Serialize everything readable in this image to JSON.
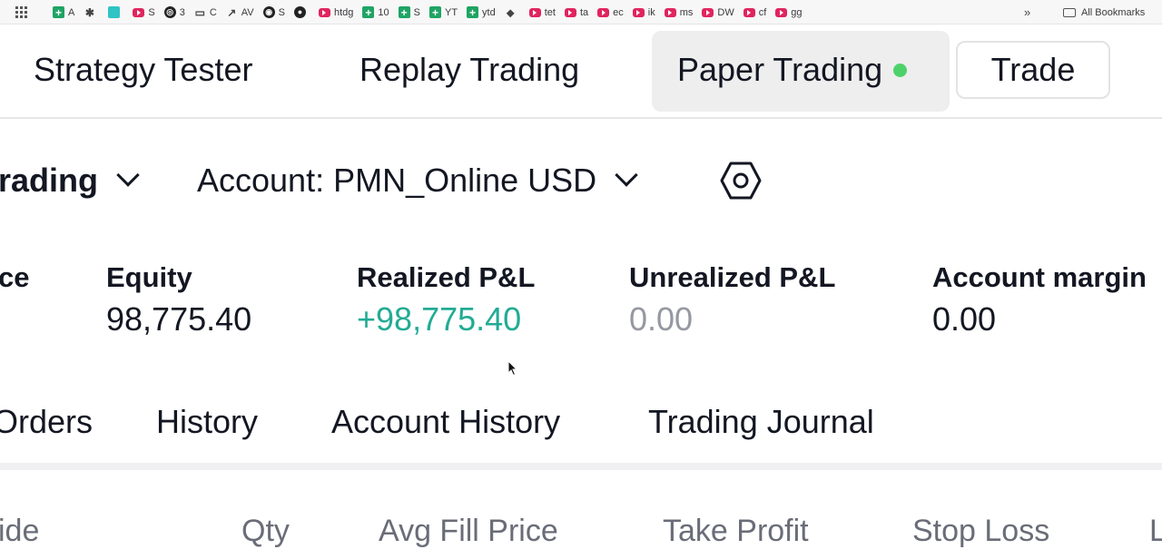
{
  "bookmarks_bar": {
    "items": [
      {
        "icon": "sheets-icon",
        "label": "A"
      },
      {
        "icon": "puzzle-icon",
        "label": ""
      },
      {
        "icon": "app-icon",
        "label": ""
      },
      {
        "icon": "youtube-icon",
        "label": "S"
      },
      {
        "icon": "openai-icon",
        "label": "3"
      },
      {
        "icon": "folder-icon",
        "label": "C"
      },
      {
        "icon": "chart-icon",
        "label": "AV"
      },
      {
        "icon": "globe-icon",
        "label": "S"
      },
      {
        "icon": "github-icon",
        "label": ""
      },
      {
        "icon": "youtube-icon",
        "label": "htdg"
      },
      {
        "icon": "sheets-icon",
        "label": "10"
      },
      {
        "icon": "sheets-icon",
        "label": "S"
      },
      {
        "icon": "sheets-icon",
        "label": "YT"
      },
      {
        "icon": "sheets-icon",
        "label": "ytd"
      },
      {
        "icon": "pin-icon",
        "label": ""
      },
      {
        "icon": "youtube-icon",
        "label": "tet"
      },
      {
        "icon": "youtube-icon",
        "label": "ta"
      },
      {
        "icon": "youtube-icon",
        "label": "ec"
      },
      {
        "icon": "youtube-icon",
        "label": "ik"
      },
      {
        "icon": "youtube-icon",
        "label": "ms"
      },
      {
        "icon": "youtube-icon",
        "label": "DW"
      },
      {
        "icon": "youtube-icon",
        "label": "cf"
      },
      {
        "icon": "youtube-icon",
        "label": "gg"
      }
    ],
    "more_label": "»",
    "all_bookmarks_label": "All Bookmarks"
  },
  "top_nav": {
    "tabs": [
      {
        "label": "Strategy Tester"
      },
      {
        "label": "Replay Trading"
      },
      {
        "label": "Paper Trading",
        "active": true,
        "status": "live"
      }
    ],
    "trade_label": "Trade",
    "live_color": "#4cd26b"
  },
  "account_bar": {
    "mode_label": "rading",
    "account_label": "Account: PMN_Online USD"
  },
  "metrics": [
    {
      "label": "ce",
      "value": ""
    },
    {
      "label": "Equity",
      "value": "98,775.40"
    },
    {
      "label": "Realized P&L",
      "value": "+98,775.40",
      "tone": "positive"
    },
    {
      "label": "Unrealized P&L",
      "value": "0.00",
      "tone": "muted"
    },
    {
      "label": "Account margin",
      "value": "0.00"
    }
  ],
  "bottom_tabs": [
    {
      "label": "Orders"
    },
    {
      "label": "History"
    },
    {
      "label": "Account History"
    },
    {
      "label": "Trading Journal"
    }
  ],
  "columns": [
    "ide",
    "Qty",
    "Avg Fill Price",
    "Take Profit",
    "Stop Loss",
    "L"
  ],
  "colors": {
    "positive": "#22ab94",
    "muted": "#9598a1",
    "text": "#131722"
  }
}
